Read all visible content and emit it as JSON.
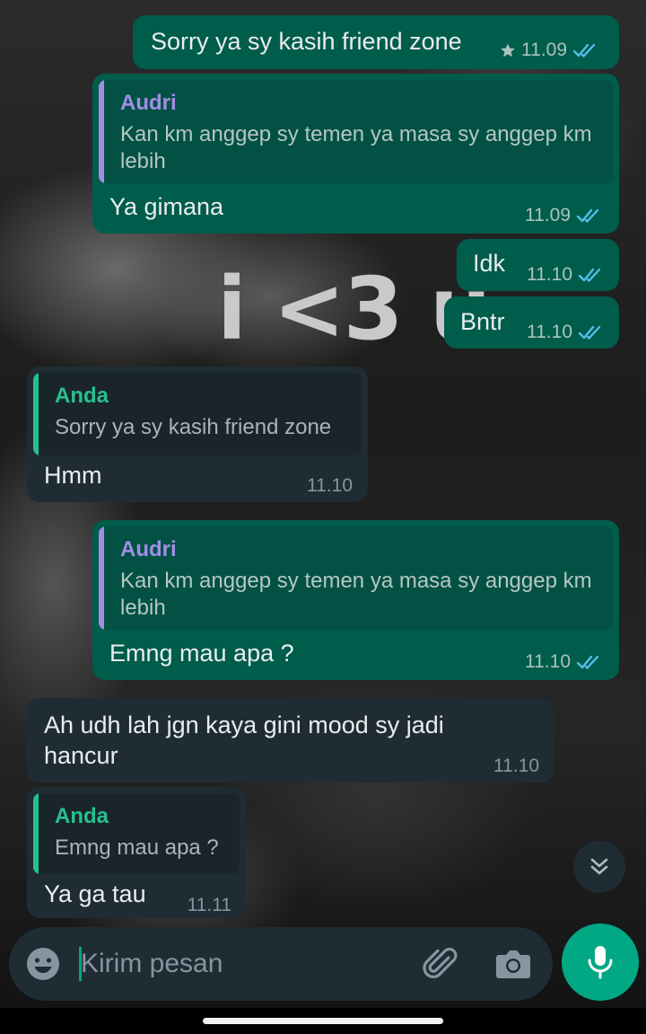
{
  "chat": {
    "overlay_text": "i <3 u",
    "messages": [
      {
        "dir": "out",
        "text": "Sorry ya sy kasih friend zone",
        "time": "11.09",
        "starred": true,
        "ticks": "read"
      },
      {
        "dir": "out",
        "quote": {
          "name": "Audri",
          "text": "Kan km anggep sy temen ya masa sy anggep km lebih"
        },
        "text": "Ya gimana",
        "time": "11.09",
        "ticks": "read"
      },
      {
        "dir": "out",
        "text": "Idk",
        "time": "11.10",
        "ticks": "read"
      },
      {
        "dir": "out",
        "text": "Bntr",
        "time": "11.10",
        "ticks": "read"
      },
      {
        "dir": "in",
        "quote": {
          "name": "Anda",
          "text": "Sorry ya sy kasih friend zone"
        },
        "text": "Hmm",
        "time": "11.10"
      },
      {
        "dir": "out",
        "quote": {
          "name": "Audri",
          "text": "Kan km anggep sy temen ya masa sy anggep km lebih"
        },
        "text": "Emng mau apa ?",
        "time": "11.10",
        "ticks": "read"
      },
      {
        "dir": "in",
        "text": "Ah udh lah jgn kaya gini mood sy jadi hancur",
        "time": "11.10"
      },
      {
        "dir": "in",
        "quote": {
          "name": "Anda",
          "text": "Emng mau apa ?"
        },
        "text": "Ya ga tau",
        "time": "11.11"
      }
    ]
  },
  "composer": {
    "placeholder": "Kirim pesan",
    "icons": {
      "emoji": "emoji-icon",
      "attach": "paperclip-icon",
      "camera": "camera-icon",
      "mic": "microphone-icon",
      "scroll": "double-chevron-down-icon"
    }
  },
  "colors": {
    "outgoing_bubble": "#005c4b",
    "incoming_bubble": "#1f2c33",
    "quote_name_audri": "#a28ee6",
    "quote_name_anda": "#25c18d",
    "read_ticks": "#53bdeb",
    "accent": "#00a884"
  }
}
